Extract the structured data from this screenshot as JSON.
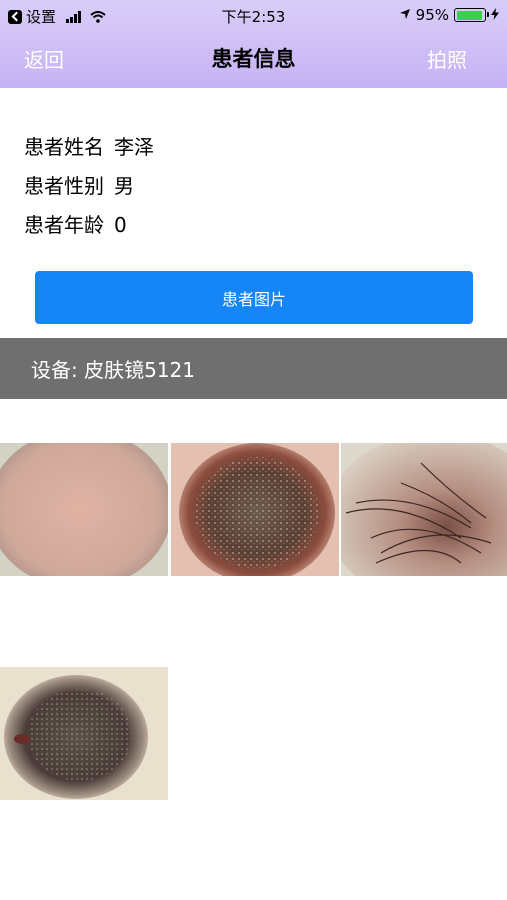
{
  "status_bar": {
    "back_app": "设置",
    "time": "下午2:53",
    "battery": "95%",
    "battery_level": 0.95
  },
  "nav": {
    "back": "返回",
    "title": "患者信息",
    "camera": "拍照"
  },
  "patient": {
    "name_label": "患者姓名",
    "name": "李泽",
    "gender_label": "患者性别",
    "gender": "男",
    "age_label": "患者年龄",
    "age": "0"
  },
  "images_button": "患者图片",
  "device": "设备: 皮肤镜5121",
  "photos": [
    "skin-image-plain",
    "skin-image-lesion",
    "skin-image-hair",
    "skin-image-dark-lesion"
  ]
}
